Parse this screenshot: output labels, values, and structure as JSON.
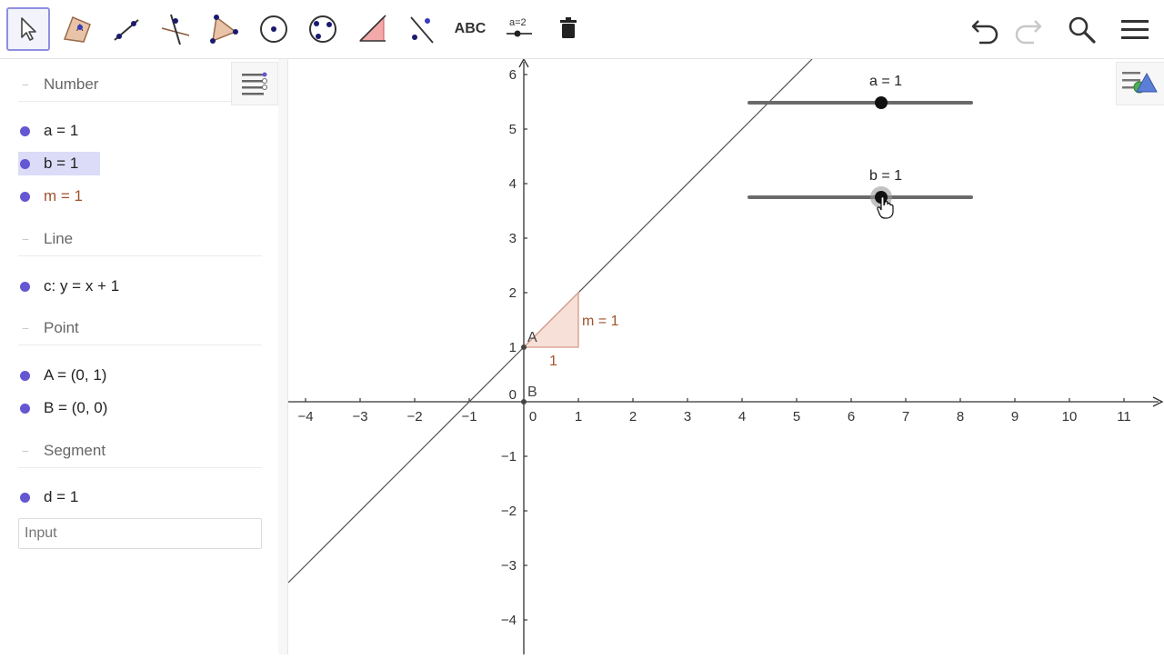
{
  "toolbar": {
    "text_tool_label": "ABC",
    "slider_tool_label": "a=2"
  },
  "algebra": {
    "sections": [
      {
        "header": "Number",
        "items": [
          "a = 1",
          "b = 1",
          "m = 1"
        ]
      },
      {
        "header": "Line",
        "items": [
          "c: y = x + 1"
        ]
      },
      {
        "header": "Point",
        "items": [
          "A = (0, 1)",
          "B = (0, 0)"
        ]
      },
      {
        "header": "Segment",
        "items": [
          "d = 1"
        ]
      }
    ],
    "input_placeholder": "Input"
  },
  "graphics": {
    "x_ticks": [
      "−4",
      "−3",
      "−2",
      "−1",
      "0",
      "1",
      "2",
      "3",
      "4",
      "5",
      "6",
      "7",
      "8",
      "9",
      "10",
      "11"
    ],
    "y_ticks": [
      "6",
      "5",
      "4",
      "3",
      "2",
      "1",
      "0",
      "−1",
      "−2",
      "−3",
      "−4"
    ],
    "slider_a_label": "a = 1",
    "slider_b_label": "b = 1",
    "point_A_label": "A",
    "point_B_label": "B",
    "slope_label": "m = 1",
    "slope_run_label": "1"
  },
  "colors": {
    "accent": "#6557d2",
    "slope_triangle_fill": "#f5ddd4",
    "slope_triangle_stroke": "#d79b8a",
    "slope_text": "#a0522d"
  }
}
